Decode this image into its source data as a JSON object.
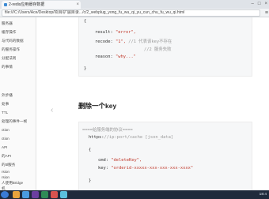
{
  "browser": {
    "tab_title": "2-redis应用缓存数据",
    "url": "file:///C:/Users/Ace/Desktop/项目/扩展目录.../c/2_webplug_yong_fu_wu_qi_yu_cun_chu_fu_wu_qi.html"
  },
  "sidebar": {
    "items": [
      {
        "label": "服务器"
      },
      {
        "label": "缓存操作"
      },
      {
        "label": "与代码的数据"
      },
      {
        "label": "的服务操作"
      },
      {
        "label": "分配法则"
      },
      {
        "label": "的事情"
      },
      {
        "label": "外步播"
      },
      {
        "label": "处事"
      },
      {
        "label": "TTL"
      },
      {
        "label": "处理的事件一帧"
      },
      {
        "label": "ction"
      },
      {
        "label": "ction"
      },
      {
        "label": "API"
      },
      {
        "label": "的API"
      },
      {
        "label": "的ttl服务"
      },
      {
        "label": "rsion"
      },
      {
        "label": "rsion"
      },
      {
        "label": "人使用Bridge"
      },
      {
        "label": "机"
      }
    ]
  },
  "code_top": {
    "lines": [
      {
        "text": "{"
      },
      {
        "key": "result: ",
        "value": "\"error\","
      },
      {
        "key": "recode: ",
        "value": "\"1\", ",
        "comment": "//1 代表该key不存在"
      },
      {
        "comment": "//2 服务失败"
      },
      {
        "key": "reason: ",
        "value": "\"why...\""
      },
      {
        "text": "}"
      }
    ]
  },
  "section_heading": "删除一个key",
  "code_bottom": {
    "lines": [
      {
        "text": "====给服务端的协议===="
      },
      {
        "key": "https:",
        "value": "//ip:port/cache [json_data]"
      },
      {
        "text": "{"
      },
      {
        "key": "cmd: ",
        "value": "\"deleteKey\","
      },
      {
        "key": "key: ",
        "value": "\"orderid-xxxxx-xxx-xxx-xxx-xxxx\""
      },
      {
        "text": "}"
      }
    ]
  },
  "taskbar": {
    "clock": "18:4"
  },
  "colors": {
    "string": "#c0392b",
    "comment": "#9a9a9a",
    "taskbar": "#1f2a3c"
  }
}
